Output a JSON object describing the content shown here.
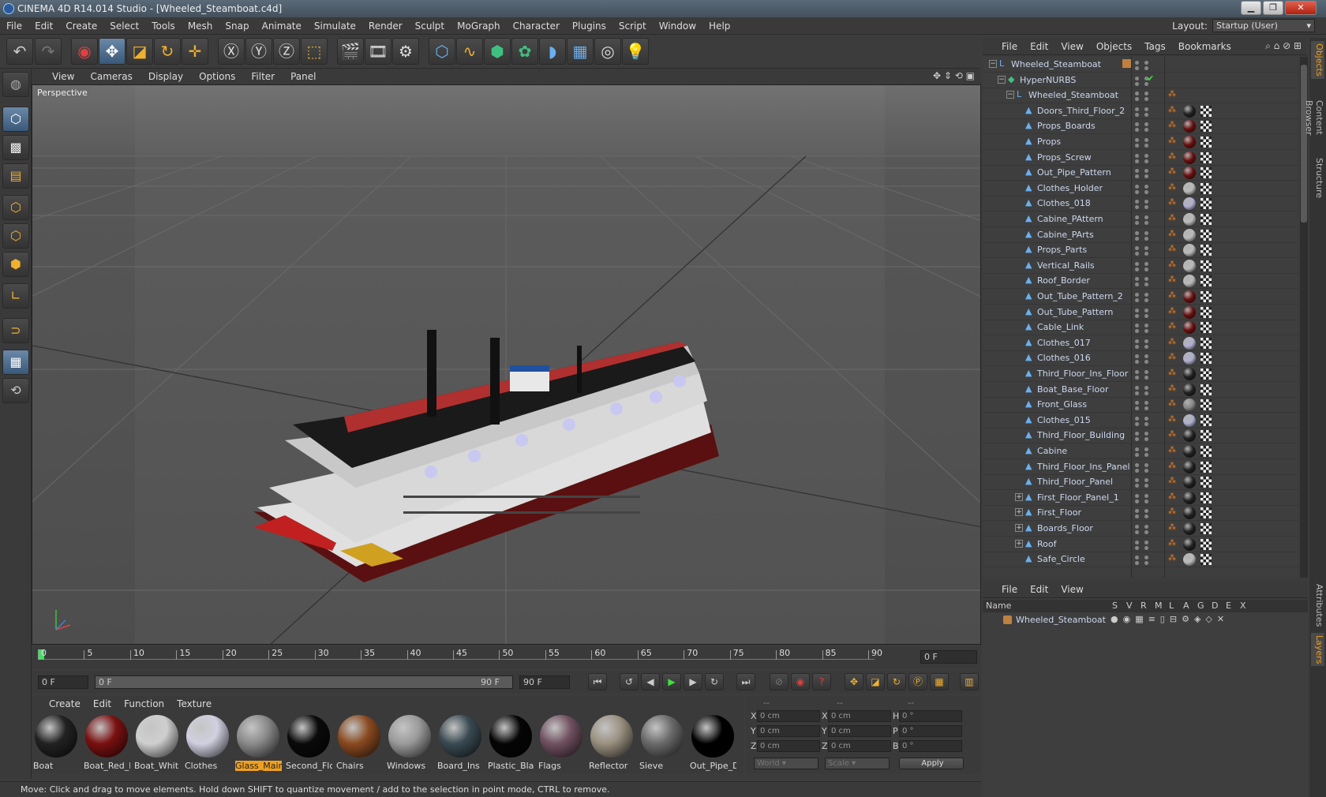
{
  "window": {
    "title": "CINEMA 4D R14.014 Studio - [Wheeled_Steamboat.c4d]"
  },
  "menu": [
    "File",
    "Edit",
    "Create",
    "Select",
    "Tools",
    "Mesh",
    "Snap",
    "Animate",
    "Simulate",
    "Render",
    "Sculpt",
    "MoGraph",
    "Character",
    "Plugins",
    "Script",
    "Window",
    "Help"
  ],
  "layout": {
    "label": "Layout:",
    "value": "Startup (User)"
  },
  "viewport": {
    "menu": [
      "View",
      "Cameras",
      "Display",
      "Options",
      "Filter",
      "Panel"
    ],
    "label": "Perspective"
  },
  "timeline": {
    "ticks": [
      "0",
      "5",
      "10",
      "15",
      "20",
      "25",
      "30",
      "35",
      "40",
      "45",
      "50",
      "55",
      "60",
      "65",
      "70",
      "75",
      "80",
      "85",
      "90"
    ],
    "current_frame": "0 F",
    "start": "0 F",
    "range_start": "0 F",
    "range_end": "90 F",
    "end": "90 F"
  },
  "materials": {
    "menu": [
      "Create",
      "Edit",
      "Function",
      "Texture"
    ],
    "items": [
      {
        "name": "Boat",
        "color": "#222222",
        "selected": false
      },
      {
        "name": "Boat_Red_l",
        "color": "#7a1010",
        "selected": false
      },
      {
        "name": "Boat_Whit",
        "color": "#cfcfcf",
        "selected": false
      },
      {
        "name": "Clothes",
        "color": "#d0d0e0",
        "selected": false
      },
      {
        "name": "Glass_Main",
        "color": "#8a8a8a",
        "selected": true
      },
      {
        "name": "Second_Flo",
        "color": "#0a0a0a",
        "selected": false
      },
      {
        "name": "Chairs",
        "color": "#8a4a20",
        "selected": false
      },
      {
        "name": "Windows",
        "color": "#9a9a9a",
        "selected": false
      },
      {
        "name": "Board_Ins",
        "color": "#3a4a52",
        "selected": false
      },
      {
        "name": "Plastic_Blac",
        "color": "#050505",
        "selected": false
      },
      {
        "name": "Flags",
        "color": "#705060",
        "selected": false
      },
      {
        "name": "Reflector",
        "color": "#9a9080",
        "selected": false
      },
      {
        "name": "Sieve",
        "color": "#6a6a6a",
        "selected": false
      },
      {
        "name": "Out_Pipe_D",
        "color": "#000000",
        "selected": false
      }
    ]
  },
  "coords": {
    "headers": [
      "--",
      "--",
      "--"
    ],
    "rows": [
      {
        "a": "X",
        "av": "0 cm",
        "b": "X",
        "bv": "0 cm",
        "c": "H",
        "cv": "0 °"
      },
      {
        "a": "Y",
        "av": "0 cm",
        "b": "Y",
        "bv": "0 cm",
        "c": "P",
        "cv": "0 °"
      },
      {
        "a": "Z",
        "av": "0 cm",
        "b": "Z",
        "bv": "0 cm",
        "c": "B",
        "cv": "0 °"
      }
    ],
    "mode1": "World",
    "mode2": "Scale",
    "apply": "Apply"
  },
  "status": "Move: Click and drag to move elements. Hold down SHIFT to quantize movement / add to the selection in point mode, CTRL to remove.",
  "object_manager": {
    "menu": [
      "File",
      "Edit",
      "View",
      "Objects",
      "Tags",
      "Bookmarks"
    ],
    "objects": [
      {
        "name": "Wheeled_Steamboat",
        "indent": 0,
        "expand": "−",
        "icon": "null-icon",
        "mat": ""
      },
      {
        "name": "HyperNURBS",
        "indent": 1,
        "expand": "−",
        "icon": "hypernurbs-icon",
        "mat": ""
      },
      {
        "name": "Wheeled_Steamboat",
        "indent": 2,
        "expand": "−",
        "icon": "null-icon",
        "mat": ""
      },
      {
        "name": "Doors_Third_Floor_2",
        "indent": 3,
        "expand": "",
        "icon": "poly-icon",
        "mat": "#222222"
      },
      {
        "name": "Props_Boards",
        "indent": 3,
        "expand": "",
        "icon": "poly-icon",
        "mat": "#6a1010"
      },
      {
        "name": "Props",
        "indent": 3,
        "expand": "",
        "icon": "poly-icon",
        "mat": "#6a1010"
      },
      {
        "name": "Props_Screw",
        "indent": 3,
        "expand": "",
        "icon": "poly-icon",
        "mat": "#6a1010"
      },
      {
        "name": "Out_Pipe_Pattern",
        "indent": 3,
        "expand": "",
        "icon": "poly-icon",
        "mat": "#6a1010"
      },
      {
        "name": "Clothes_Holder",
        "indent": 3,
        "expand": "",
        "icon": "poly-icon",
        "mat": "#bbbbbb"
      },
      {
        "name": "Clothes_018",
        "indent": 3,
        "expand": "",
        "icon": "poly-icon",
        "mat": "#b0b0d0"
      },
      {
        "name": "Cabine_PAttern",
        "indent": 3,
        "expand": "",
        "icon": "poly-icon",
        "mat": "#bbbbbb"
      },
      {
        "name": "Cabine_PArts",
        "indent": 3,
        "expand": "",
        "icon": "poly-icon",
        "mat": "#bbbbbb"
      },
      {
        "name": "Props_Parts",
        "indent": 3,
        "expand": "",
        "icon": "poly-icon",
        "mat": "#bbbbbb"
      },
      {
        "name": "Vertical_Rails",
        "indent": 3,
        "expand": "",
        "icon": "poly-icon",
        "mat": "#bbbbbb"
      },
      {
        "name": "Roof_Border",
        "indent": 3,
        "expand": "",
        "icon": "poly-icon",
        "mat": "#bbbbbb"
      },
      {
        "name": "Out_Tube_Pattern_2",
        "indent": 3,
        "expand": "",
        "icon": "poly-icon",
        "mat": "#6a1010"
      },
      {
        "name": "Out_Tube_Pattern",
        "indent": 3,
        "expand": "",
        "icon": "poly-icon",
        "mat": "#6a1010"
      },
      {
        "name": "Cable_Link",
        "indent": 3,
        "expand": "",
        "icon": "poly-icon",
        "mat": "#6a1010"
      },
      {
        "name": "Clothes_017",
        "indent": 3,
        "expand": "",
        "icon": "poly-icon",
        "mat": "#b0b0d0"
      },
      {
        "name": "Clothes_016",
        "indent": 3,
        "expand": "",
        "icon": "poly-icon",
        "mat": "#b0b0d0"
      },
      {
        "name": "Third_Floor_Ins_Floor",
        "indent": 3,
        "expand": "",
        "icon": "poly-icon",
        "mat": "#222222"
      },
      {
        "name": "Boat_Base_Floor",
        "indent": 3,
        "expand": "",
        "icon": "poly-icon",
        "mat": "#222222"
      },
      {
        "name": "Front_Glass",
        "indent": 3,
        "expand": "",
        "icon": "poly-icon",
        "mat": "#888888"
      },
      {
        "name": "Clothes_015",
        "indent": 3,
        "expand": "",
        "icon": "poly-icon",
        "mat": "#b0b0d0"
      },
      {
        "name": "Third_Floor_Building",
        "indent": 3,
        "expand": "",
        "icon": "poly-icon",
        "mat": "#222222"
      },
      {
        "name": "Cabine",
        "indent": 3,
        "expand": "",
        "icon": "poly-icon",
        "mat": "#222222"
      },
      {
        "name": "Third_Floor_Ins_Panel",
        "indent": 3,
        "expand": "",
        "icon": "poly-icon",
        "mat": "#222222"
      },
      {
        "name": "Third_Floor_Panel",
        "indent": 3,
        "expand": "",
        "icon": "poly-icon",
        "mat": "#222222"
      },
      {
        "name": "First_Floor_Panel_1",
        "indent": 3,
        "expand": "+",
        "icon": "poly-icon",
        "mat": "#222222"
      },
      {
        "name": "First_Floor",
        "indent": 3,
        "expand": "+",
        "icon": "poly-icon",
        "mat": "#222222"
      },
      {
        "name": "Boards_Floor",
        "indent": 3,
        "expand": "+",
        "icon": "poly-icon",
        "mat": "#222222"
      },
      {
        "name": "Roof",
        "indent": 3,
        "expand": "+",
        "icon": "poly-icon",
        "mat": "#222222"
      },
      {
        "name": "Safe_Circle",
        "indent": 3,
        "expand": "",
        "icon": "poly-icon",
        "mat": "#bbbbbb"
      }
    ]
  },
  "layer_manager": {
    "menu": [
      "File",
      "Edit",
      "View"
    ],
    "columns": [
      "Name",
      "S",
      "V",
      "R",
      "M",
      "L",
      "A",
      "G",
      "D",
      "E",
      "X"
    ],
    "layers": [
      {
        "name": "Wheeled_Steamboat",
        "color": "#c08040"
      }
    ]
  },
  "side_tabs": {
    "top": [
      "Objects",
      "Content Browser",
      "Structure"
    ],
    "bottom": [
      "Attributes",
      "Layers"
    ]
  }
}
